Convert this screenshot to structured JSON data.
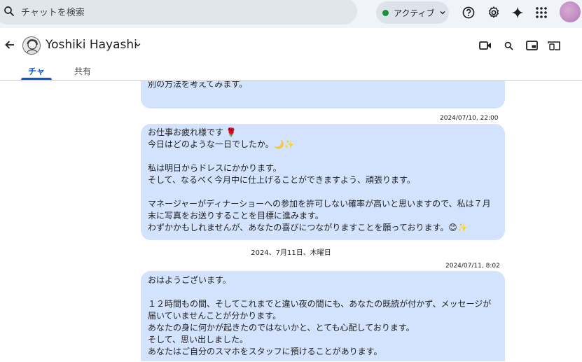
{
  "search": {
    "placeholder": "チャットを検索"
  },
  "status": {
    "label": "アクティブ",
    "color": "#1e8e3e"
  },
  "top_icons": [
    "help-icon",
    "settings-icon",
    "gemini-sparkle-icon",
    "apps-grid-icon"
  ],
  "contact": {
    "name": "Yoshiki Hayashi"
  },
  "tabs": [
    {
      "label": "チャ",
      "active": true
    },
    {
      "label": "共有",
      "active": false
    }
  ],
  "header_icons": [
    "video-call-icon",
    "search-icon",
    "pip-icon",
    "cast-icon"
  ],
  "messages": [
    {
      "lines": [
        "別の方法を考えてみます。"
      ]
    },
    {
      "timestamp": "2024/07/10, 22:00",
      "lines": [
        "お仕事お疲れ様です 🌹",
        "今日はどのような一日でしたか。🌙✨",
        "",
        "私は明日からドレスにかかります。",
        "そして、なるべく今月中に仕上げることができますよう、頑張ります。",
        "",
        "マネージャーがディナーショーへの参加を許可しない確率が高いと思いますので、私は７月",
        "末に写真をお送りすることを目標に進みます。",
        "わずかかもしれませんが、あなたの喜びにつながりますことを願っております。😊✨"
      ]
    },
    {
      "date_separator": "2024、7月11日、木曜日",
      "timestamp": "2024/07/11, 8:02",
      "lines": [
        "おはようございます。",
        "",
        "１２時間もの間、そしてこれまでと違い夜の間にも、あなたの既読が付かず、メッセージが",
        "届いていませんことが分かります。",
        "あなたの身に何かが起きたのではないかと、とても心配しております。",
        "そして、思い出しました。",
        "あなたはご自分のスマホをスタッフに預けることがあります。"
      ]
    }
  ],
  "colors": {
    "bubble": "#d3e3fd",
    "accent": "#0b57d0",
    "page_bg": "#f0f4f9"
  }
}
